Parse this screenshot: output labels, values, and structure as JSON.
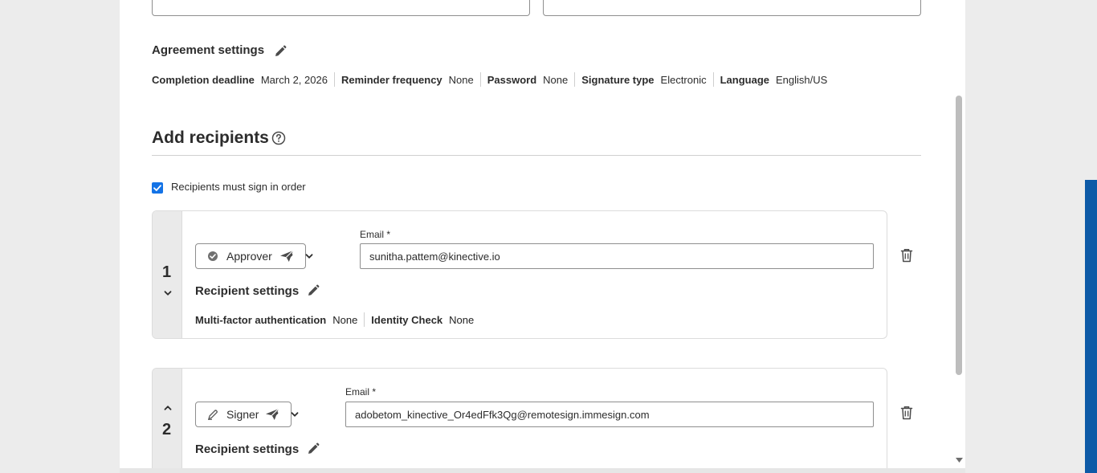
{
  "agreement_settings": {
    "title": "Agreement settings",
    "items": [
      {
        "label": "Completion deadline",
        "value": "March 2, 2026"
      },
      {
        "label": "Reminder frequency",
        "value": "None"
      },
      {
        "label": "Password",
        "value": "None"
      },
      {
        "label": "Signature type",
        "value": "Electronic"
      },
      {
        "label": "Language",
        "value": "English/US"
      }
    ]
  },
  "add_recipients": {
    "title": "Add recipients",
    "sign_in_order_label": "Recipients must sign in order",
    "sign_in_order_checked": true
  },
  "recipients": [
    {
      "number": "1",
      "role": "Approver",
      "email_label": "Email",
      "required_mark": "*",
      "email": "sunitha.pattem@kinective.io",
      "settings_title": "Recipient settings",
      "settings": [
        {
          "label": "Multi-factor authentication",
          "value": "None"
        },
        {
          "label": "Identity Check",
          "value": "None"
        }
      ]
    },
    {
      "number": "2",
      "role": "Signer",
      "email_label": "Email",
      "required_mark": "*",
      "email": "adobetom_kinective_Or4edFfk3Qg@remotesign.immesign.com",
      "settings_title": "Recipient settings"
    }
  ],
  "colors": {
    "accent": "#1473e6",
    "side_panel": "#0d5aa7"
  }
}
